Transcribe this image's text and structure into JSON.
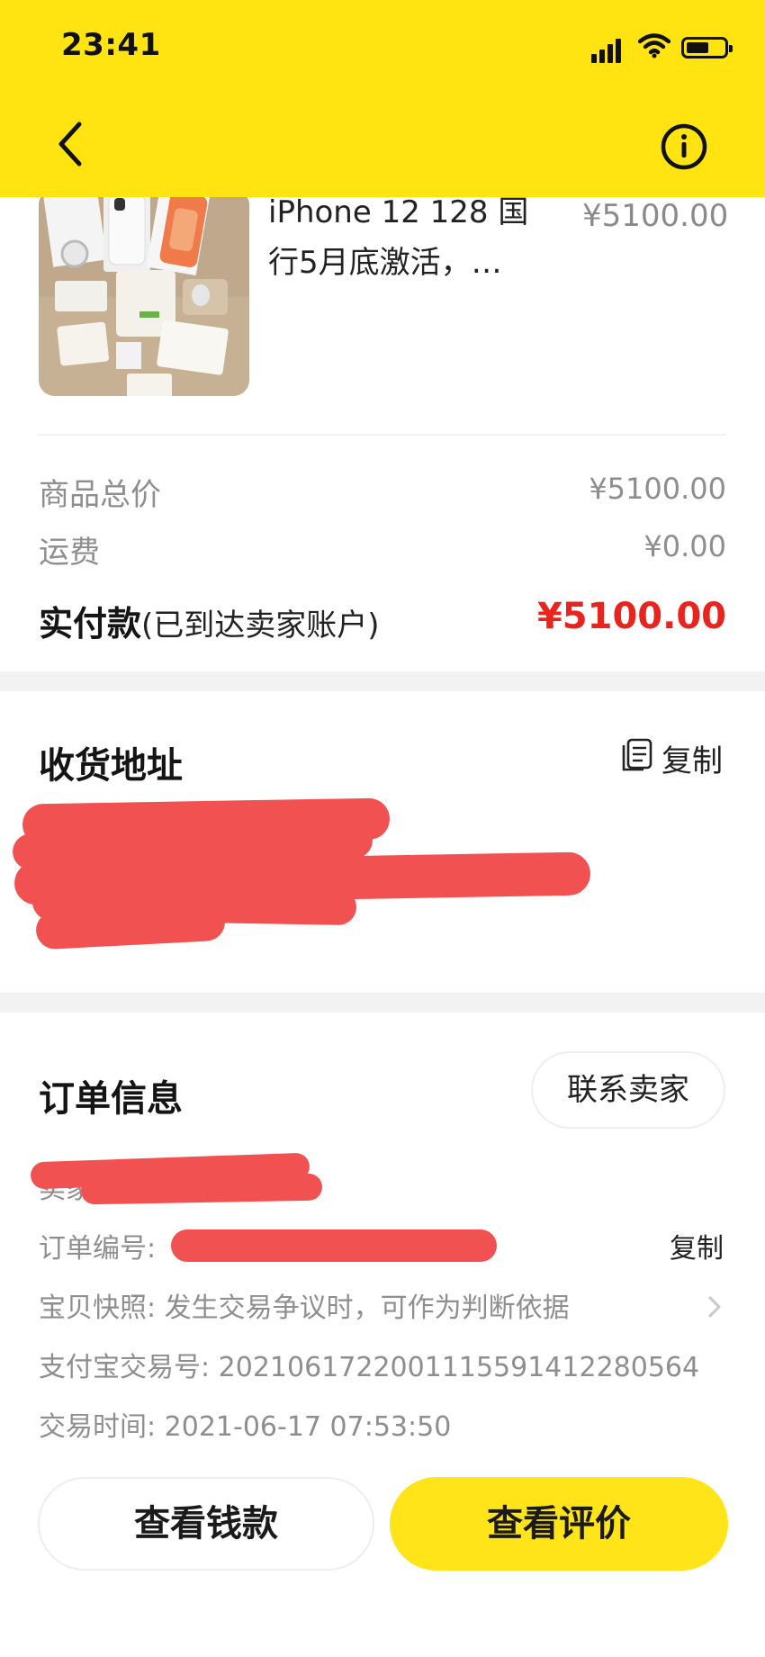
{
  "status_bar": {
    "time": "23:41"
  },
  "colors": {
    "brand_yellow": "#ffe412",
    "price_red": "#e9231d",
    "redaction": "#f25151"
  },
  "header": {
    "back_icon": "chevron-left-icon",
    "info_icon": "info-circle-icon"
  },
  "product": {
    "title": "iPhone 12 128 国行5月底激活，…",
    "price": "¥5100.00"
  },
  "summary": {
    "subtotal_label": "商品总价",
    "subtotal_value": "¥5100.00",
    "shipping_label": "运费",
    "shipping_value": "¥0.00",
    "paid_label": "实付款",
    "paid_note": "(已到达卖家账户)",
    "paid_value": "¥5100.00"
  },
  "address": {
    "title": "收货地址",
    "copy_label": "复制",
    "copy_icon": "copy-document-icon"
  },
  "order": {
    "title": "订单信息",
    "contact_label": "联系卖家",
    "seller_label": "卖家",
    "order_no_label": "订单编号:",
    "order_no_copy": "复制",
    "snapshot_label": "宝贝快照:",
    "snapshot_text": "发生交易争议时，可作为判断依据",
    "alipay_label": "支付宝交易号:",
    "alipay_value": "2021061722001115591412280564",
    "time_label": "交易时间:",
    "time_value": "2021-06-17 07:53:50"
  },
  "actions": {
    "view_money": "查看钱款",
    "view_review": "查看评价"
  }
}
